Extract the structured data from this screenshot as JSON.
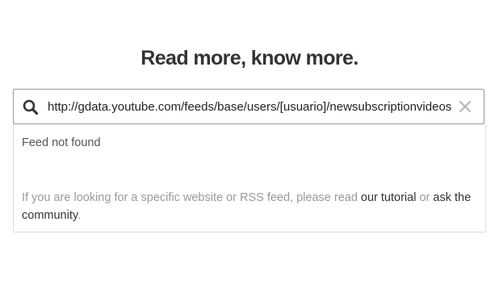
{
  "header": {
    "title": "Read more, know more."
  },
  "search": {
    "value": "http://gdata.youtube.com/feeds/base/users/[usuario]/newsubscriptionvideos",
    "icon": "search-icon",
    "clear_icon": "close-icon"
  },
  "results": {
    "status": "Feed not found",
    "help_prefix": "If you are looking for a specific website or RSS feed, please read ",
    "tutorial_link": "our tutorial",
    "help_middle": " or ",
    "community_link": "ask the community",
    "help_suffix": "."
  },
  "colors": {
    "text": "#333333",
    "muted": "#9a9a9a",
    "border": "#9a9a9a"
  }
}
